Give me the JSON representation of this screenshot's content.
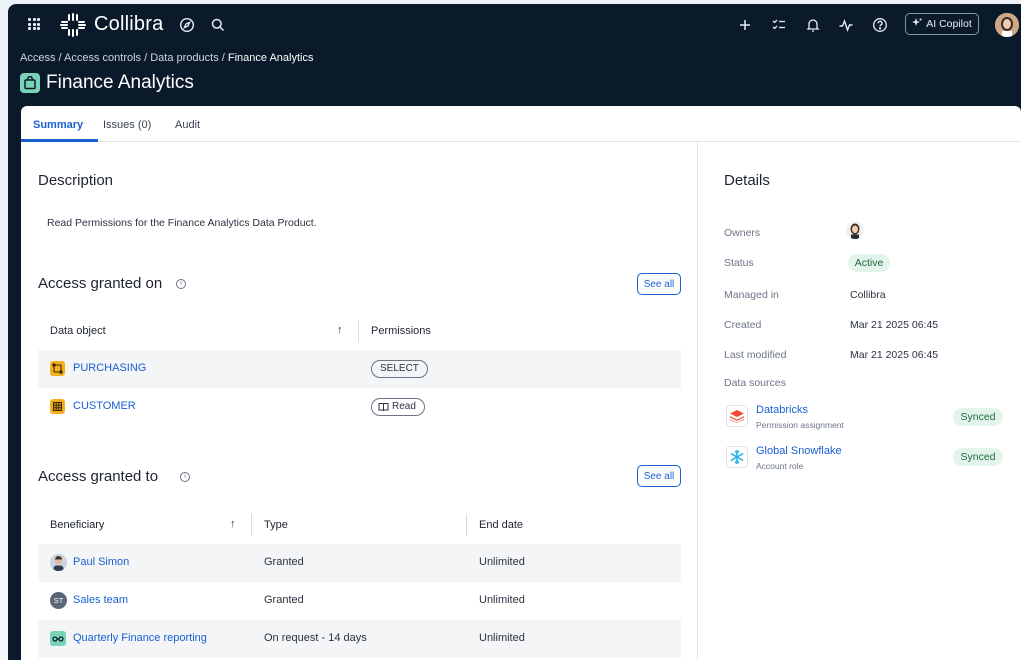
{
  "app": {
    "name": "Collibra",
    "copilot_label": "AI Copilot"
  },
  "breadcrumb": {
    "items": [
      "Access",
      "Access controls",
      "Data products"
    ],
    "current": "Finance Analytics",
    "separator": " / "
  },
  "page": {
    "title": "Finance Analytics"
  },
  "tabs": [
    {
      "label": "Summary",
      "active": true
    },
    {
      "label": "Issues (0)",
      "active": false
    },
    {
      "label": "Audit",
      "active": false
    }
  ],
  "description": {
    "heading": "Description",
    "text": "Read Permissions for the Finance Analytics Data Product."
  },
  "access_granted_on": {
    "heading": "Access granted on",
    "see_all": "See all",
    "columns": [
      "Data object",
      "Permissions"
    ],
    "rows": [
      {
        "name": "PURCHASING",
        "permission": "SELECT"
      },
      {
        "name": "CUSTOMER",
        "permission": "Read"
      }
    ]
  },
  "access_granted_to": {
    "heading": "Access granted to",
    "see_all": "See all",
    "columns": [
      "Beneficiary",
      "Type",
      "End date"
    ],
    "rows": [
      {
        "name": "Paul Simon",
        "type": "Granted",
        "end": "Unlimited",
        "avatar": "person"
      },
      {
        "name": "Sales team",
        "type": "Granted",
        "end": "Unlimited",
        "avatar": "ST"
      },
      {
        "name": "Quarterly Finance reporting",
        "type": "On request - 14 days",
        "end": "Unlimited",
        "avatar": "glasses"
      }
    ]
  },
  "details": {
    "heading": "Details",
    "labels": {
      "owners": "Owners",
      "status": "Status",
      "managed_in": "Managed in",
      "created": "Created",
      "last_modified": "Last modified",
      "data_sources": "Data sources"
    },
    "status": "Active",
    "managed_in": "Collibra",
    "created": "Mar 21 2025 06:45",
    "last_modified": "Mar 21 2025 06:45",
    "sources": [
      {
        "name": "Databricks",
        "sub": "Permission assignment",
        "state": "Synced"
      },
      {
        "name": "Global Snowflake",
        "sub": "Account role",
        "state": "Synced"
      }
    ]
  },
  "colors": {
    "nav_bg": "#0b1a2b",
    "link": "#1a5fd0",
    "success_bg": "#e3f4ea",
    "object_icon": "#f5b01e",
    "product_icon": "#7ad3b8"
  }
}
